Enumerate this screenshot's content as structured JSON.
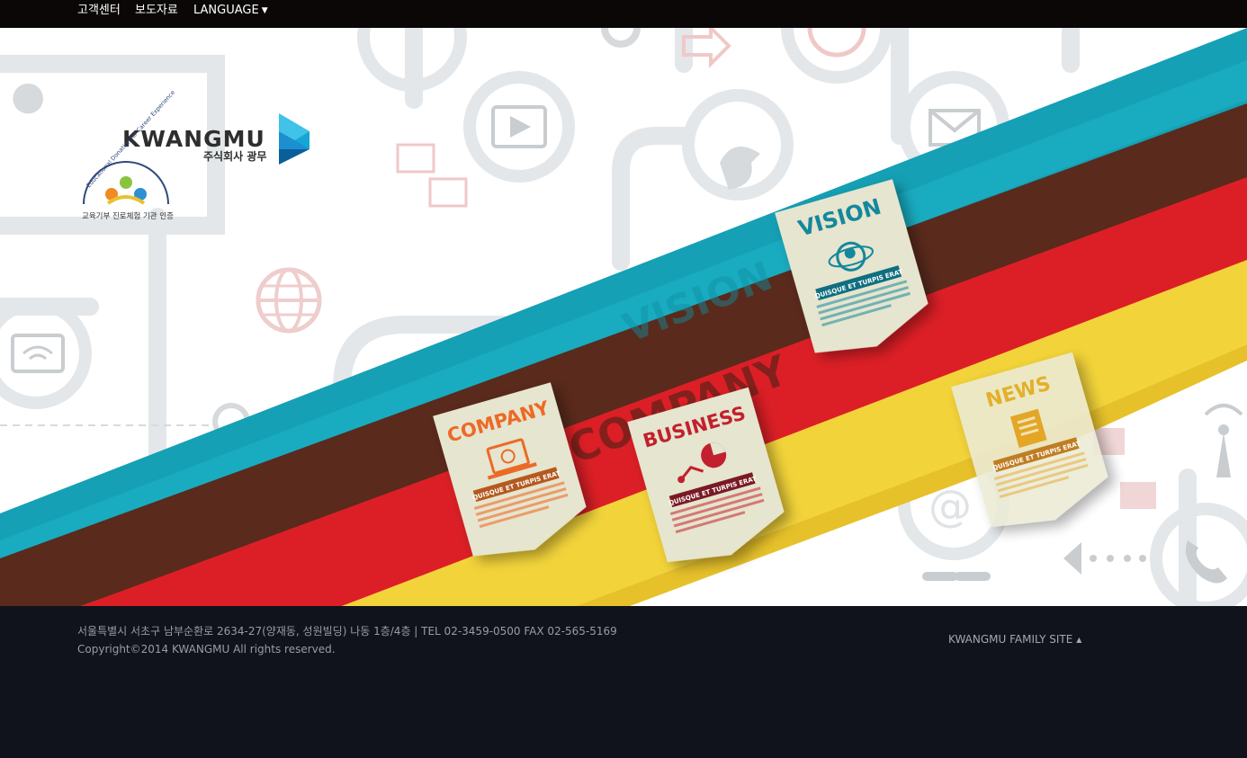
{
  "topnav": {
    "customer_center": "고객센터",
    "press": "보도자료",
    "language": "LANGUAGE"
  },
  "logo": {
    "brand": "KWANGMU",
    "sub": "주식회사 광무"
  },
  "badge": {
    "arc_text": "Educational Donation for Career Experience",
    "caption": "교육기부 진로체험 기관 인증"
  },
  "cards": {
    "vision": {
      "title": "VISION",
      "tag": "QUISQUE ET TURPIS ERAT"
    },
    "company": {
      "title": "COMPANY",
      "tag": "QUISQUE ET TURPIS ERAT"
    },
    "business": {
      "title": "BUSINESS",
      "tag": "QUISQUE ET TURPIS ERAT"
    },
    "news": {
      "title": "NEWS",
      "tag": "QUISQUE ET TURPIS ERAT"
    }
  },
  "ribbon_text": {
    "vision": "VISION",
    "company": "COMPANY"
  },
  "footer": {
    "address": "서울특별시 서초구 남부순환로 2634-27(양재동, 성원빌딩) 나동 1층/4층 | TEL 02-3459-0500 FAX 02-565-5169",
    "copyright": "Copyright©2014 KWANGMU All rights reserved.",
    "family_site": "KWANGMU FAMILY SITE"
  },
  "colors": {
    "teal": "#17a3b8",
    "brown": "#5a2a1c",
    "red": "#dc1f26",
    "yellow": "#f2d33a",
    "card": "#e6e5cf",
    "footer_bg": "#11131c"
  }
}
